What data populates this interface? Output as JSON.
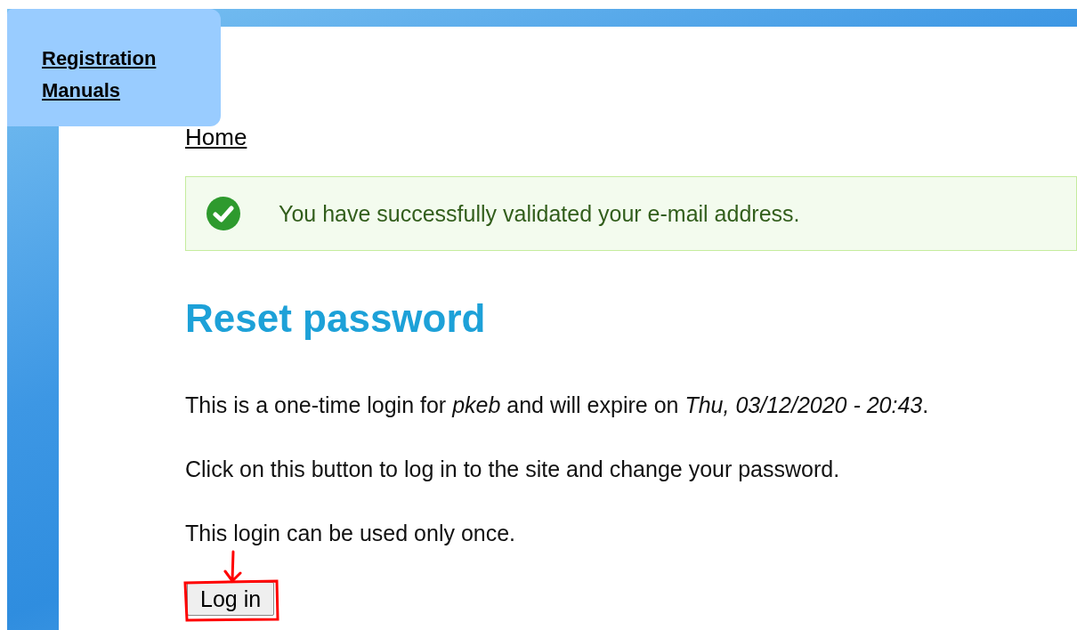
{
  "nav_tab": {
    "link": "Registration Manuals"
  },
  "breadcrumb": {
    "link": "Home"
  },
  "status_message": {
    "kind": "success",
    "text": "You have successfully validated your e-mail address."
  },
  "heading": "Reset password",
  "paragraphs": [
    "This is a one-time login for *pkeb* and will expire on *Thu, 03/12/2020 - 20:43*.",
    "Click on this button to log in to the site and change your password.",
    "This login can be used only once."
  ],
  "button": {
    "label": "Log in"
  }
}
